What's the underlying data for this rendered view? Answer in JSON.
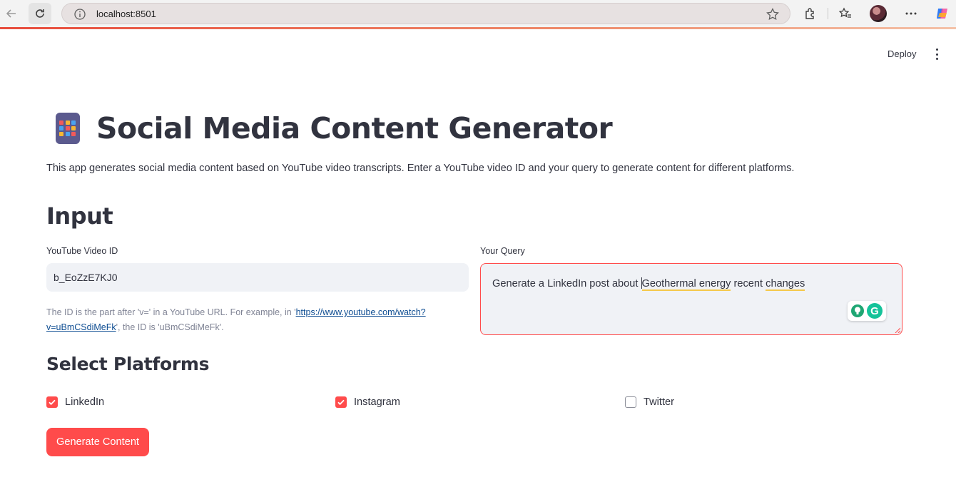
{
  "browser": {
    "url": "localhost:8501"
  },
  "header": {
    "deploy_label": "Deploy"
  },
  "app": {
    "title": "Social Media Content Generator",
    "description": "This app generates social media content based on YouTube video transcripts. Enter a YouTube video ID and your query to generate content for different platforms.",
    "input_heading": "Input",
    "video_id": {
      "label": "YouTube Video ID",
      "value": "b_EoZzE7KJ0",
      "help_prefix": "The ID is the part after 'v=' in a YouTube URL. For example, in '",
      "help_link": "https://www.youtube.com/watch?v=uBmCSdiMeFk",
      "help_suffix": "', the ID is 'uBmCSdiMeFk'."
    },
    "query": {
      "label": "Your Query",
      "part1": "Generate a LinkedIn post about ",
      "part2": "Geothermal energy",
      "part3": " recent ",
      "part4": "changes"
    },
    "platforms_heading": "Select Platforms",
    "platforms": [
      {
        "label": "LinkedIn",
        "checked": true
      },
      {
        "label": "Instagram",
        "checked": true
      },
      {
        "label": "Twitter",
        "checked": false
      }
    ],
    "generate_label": "Generate Content"
  },
  "colors": {
    "accent": "#ff4b4b",
    "text": "#31333f",
    "input_bg": "#f0f2f6",
    "link": "#0e4d92"
  }
}
